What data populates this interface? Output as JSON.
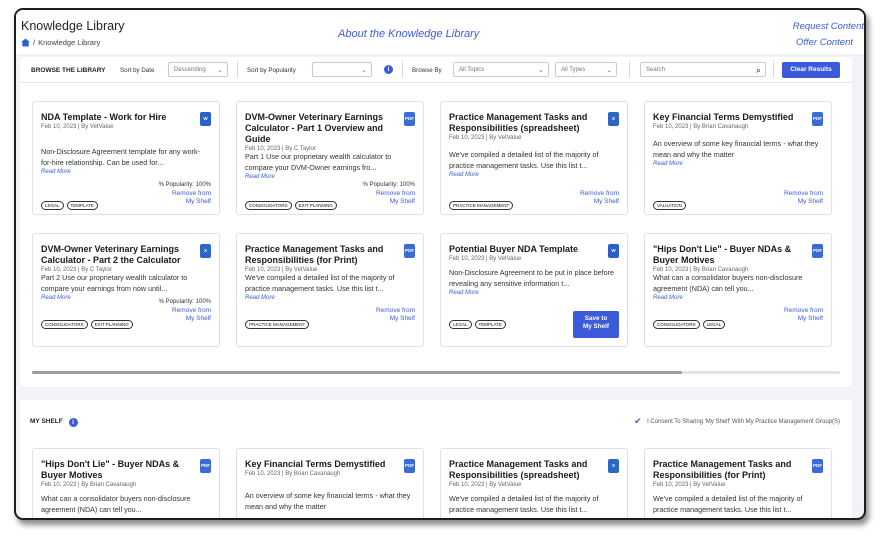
{
  "header": {
    "title": "Knowledge Library",
    "breadcrumb_sep": "/",
    "breadcrumb": "Knowledge Library",
    "about": "About the Knowledge Library",
    "request": "Request Content",
    "offer": "Offer Content"
  },
  "filters": {
    "browse_label": "BROWSE THE LIBRARY",
    "sort_date_label": "Sort by Date",
    "sort_date_value": "Descending",
    "sort_pop_label": "Sort by Popularity",
    "sort_pop_value": "",
    "info": "i",
    "browse_by_label": "Browse By",
    "topics_value": "All Topics",
    "types_value": "All Types",
    "search_placeholder": "Search",
    "clear_label": "Clear Results"
  },
  "cards": [
    {
      "title": "NDA Template - Work for Hire",
      "meta": "Feb 10, 2023 | By VetValue",
      "desc": "Non-Disclosure Agreement template for any work-for-hire relationship. Can be used for...",
      "read": "Read More",
      "popularity": "% Popularity: 100%",
      "action1": "Remove from",
      "action2": "My Shelf",
      "tags": [
        "LEGAL",
        "TEMPLATE"
      ],
      "icon": "W"
    },
    {
      "title": "DVM-Owner Veterinary Earnings Calculator - Part 1 Overview and Guide",
      "meta": "Feb 10, 2023 | By C Taylor",
      "desc": "Part 1 Use our proprietary wealth calculator to compare your DVM-Owner earnings fro...",
      "read": "Read More",
      "popularity": "% Popularity: 100%",
      "action1": "Remove from",
      "action2": "My Shelf",
      "tags": [
        "CONSOLIDATORS",
        "EXIT PLANNING"
      ],
      "icon": "PDF"
    },
    {
      "title": "Practice Management Tasks and Responsibilities (spreadsheet)",
      "meta": "Feb 10, 2023 | By VetValue",
      "desc": "We've compiled a detailed list of the majority of practice management tasks. Use this list t...",
      "read": "Read More",
      "action1": "Remove from",
      "action2": "My Shelf",
      "tags": [
        "PRACTICE MANAGEMENT"
      ],
      "icon": "X"
    },
    {
      "title": "Key Financial Terms Demystified",
      "meta": "Feb 10, 2023 | By Brian Cavanaugh",
      "desc": "An overview of some key financial terms - what they mean and why the matter",
      "read": "Read More",
      "action1": "Remove from",
      "action2": "My Shelf",
      "tags": [
        "VALUATION"
      ],
      "icon": "PDF"
    },
    {
      "title": "DVM-Owner Veterinary Earnings Calculator - Part 2 the Calculator",
      "meta": "Feb 10, 2023 | By C Taylor",
      "desc": "Part 2 Use our proprietary wealth calculator to compare your earnings from now until...",
      "read": "Read More",
      "popularity": "% Popularity: 100%",
      "action1": "Remove from",
      "action2": "My Shelf",
      "tags": [
        "CONSOLIDATORS",
        "EXIT PLANNING"
      ],
      "icon": "X"
    },
    {
      "title": "Practice Management Tasks and Responsibilities (for Print)",
      "meta": "Feb 10, 2023 | By VetValue",
      "desc": "We've compiled a detailed list of the majority of practice management tasks. Use this list t...",
      "read": "Read More",
      "action1": "Remove from",
      "action2": "My Shelf",
      "tags": [
        "PRACTICE MANAGEMENT"
      ],
      "icon": "PDF"
    },
    {
      "title": "Potential Buyer NDA Template",
      "meta": "Feb 10, 2023 | By VetValue",
      "desc": "Non-Disclosure Agreement to be put in place before revealing any sensitive information t...",
      "read": "Read More",
      "save1": "Save to",
      "save2": "My Shelf",
      "tags": [
        "LEGAL",
        "TEMPLATE"
      ],
      "icon": "W"
    },
    {
      "title": "\"Hips Don't Lie\" - Buyer NDAs & Buyer Motives",
      "meta": "Feb 10, 2023 | By Brian Cavanaugh",
      "desc": "What can a consolidator buyers non-disclosure agreement (NDA) can tell you...",
      "read": "Read More",
      "action1": "Remove from",
      "action2": "My Shelf",
      "tags": [
        "CONSOLIDATORS",
        "LEGAL"
      ],
      "icon": "PDF"
    }
  ],
  "shelf": {
    "title": "MY SHELF",
    "info": "i",
    "consent": "I Consent To Sharing 'My Shelf' With My Practice Management Group(S)",
    "cards": [
      {
        "title": "\"Hips Don't Lie\" - Buyer NDAs & Buyer Motives",
        "meta": "Feb 10, 2023 | By Brian Cavanaugh",
        "desc": "What can a consolidator buyers non-disclosure agreement (NDA) can tell you...",
        "icon": "PDF"
      },
      {
        "title": "Key Financial Terms Demystified",
        "meta": "Feb 10, 2023 | By Brian Cavanaugh",
        "desc": "An overview of some key financial terms - what they mean and why the matter",
        "icon": "PDF"
      },
      {
        "title": "Practice Management Tasks and Responsibilities (spreadsheet)",
        "meta": "Feb 10, 2023 | By VetValue",
        "desc": "We've compiled a detailed list of the majority of practice management tasks. Use this list t...",
        "icon": "X"
      },
      {
        "title": "Practice Management Tasks and Responsibilities (for Print)",
        "meta": "Feb 10, 2023 | By VetValue",
        "desc": "We've compiled a detailed list of the majority of practice management tasks. Use this list t...",
        "icon": "PDF"
      }
    ]
  },
  "colors": {
    "accent": "#3b5bdb",
    "border": "#dfe1e5",
    "background": "#f2f3f6"
  }
}
